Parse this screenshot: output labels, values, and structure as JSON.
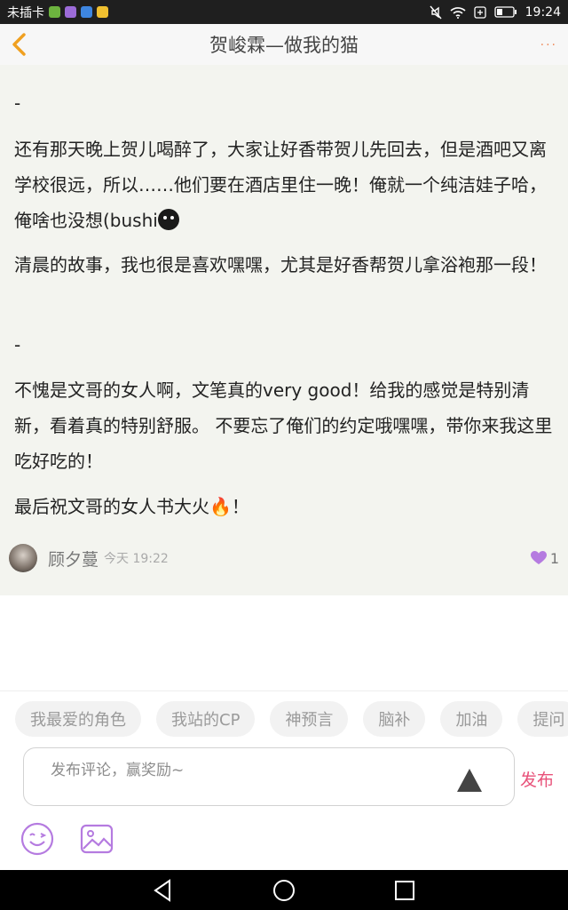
{
  "status_bar": {
    "carrier": "未插卡",
    "time": "19:24"
  },
  "header": {
    "title": "贺峻霖—做我的猫",
    "more": "···"
  },
  "comment": {
    "paragraphs": [
      "-",
      "还有那天晚上贺儿喝醉了，大家让好香带贺儿先回去，但是酒吧又离学校很远，所以……他们要在酒店里住一晚！俺就一个纯洁娃子哈，俺啥也没想(bushi",
      "清晨的故事，我也很是喜欢嘿嘿，尤其是好香帮贺儿拿浴袍那一段！",
      "-",
      "不愧是文哥的女人啊，文笔真的very good！给我的感觉是特别清新，看着真的特别舒服。 不要忘了俺们的约定哦嘿嘿，带你来我这里吃好吃的！",
      "最后祝文哥的女人书大火🔥！"
    ],
    "author": "顾夕蔓",
    "time": "今天 19:22",
    "likes": "1"
  },
  "composer": {
    "chips": [
      "我最爱的角色",
      "我站的CP",
      "神预言",
      "脑补",
      "加油",
      "提问"
    ],
    "placeholder": "发布评论，赢奖励~",
    "publish_label": "发布"
  },
  "colors": {
    "accent": "#e8527a",
    "like": "#b57be0",
    "back": "#f0a020"
  }
}
